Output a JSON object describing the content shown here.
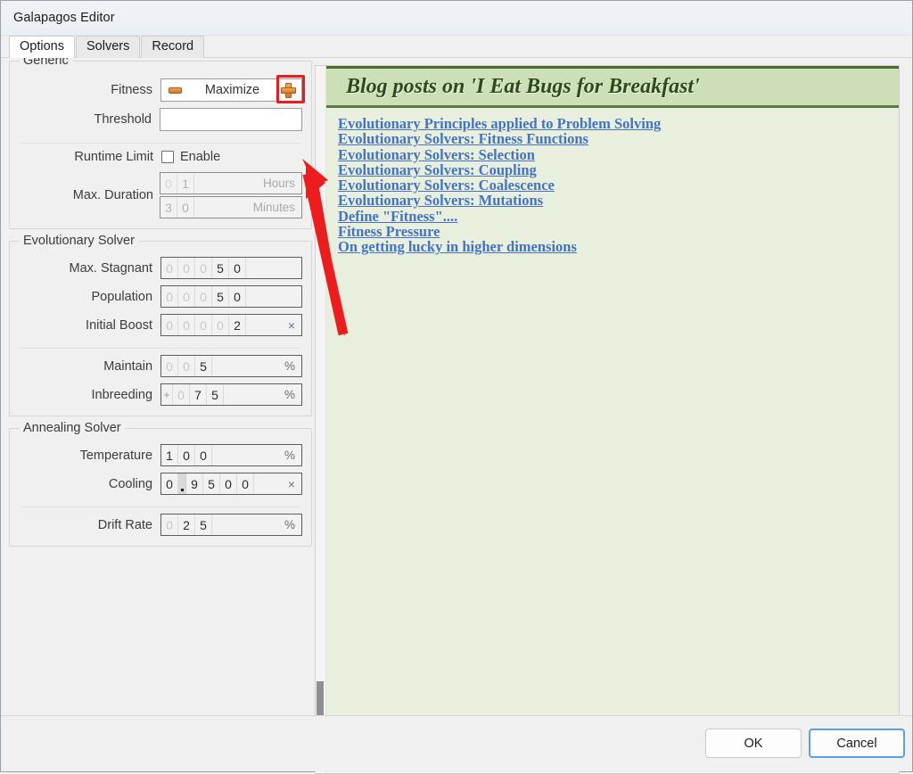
{
  "window": {
    "title": "Galapagos Editor"
  },
  "tabs": [
    {
      "label": "Options",
      "active": true
    },
    {
      "label": "Solvers",
      "active": false
    },
    {
      "label": "Record",
      "active": false
    }
  ],
  "generic": {
    "group_title": "Generic",
    "fitness": {
      "label": "Fitness",
      "value": "Maximize",
      "minus_icon": "minus-icon",
      "plus_icon": "plus-icon",
      "highlight_color": "#e81d1d"
    },
    "threshold": {
      "label": "Threshold",
      "value": "",
      "placeholder": ""
    },
    "runtime_limit": {
      "label": "Runtime Limit",
      "checkbox_label": "Enable",
      "checked": false
    },
    "max_duration": {
      "label": "Max. Duration",
      "hours": {
        "digits": [
          "0",
          "1"
        ],
        "lead_count": 1,
        "unit": "Hours",
        "disabled": true
      },
      "minutes": {
        "digits": [
          "3",
          "0"
        ],
        "lead_count": 0,
        "unit": "Minutes",
        "disabled": true
      }
    }
  },
  "evolutionary_solver": {
    "group_title": "Evolutionary Solver",
    "fields": [
      {
        "label": "Max. Stagnant",
        "digits": [
          "0",
          "0",
          "0",
          "5",
          "0"
        ],
        "lead_count": 3,
        "unit": ""
      },
      {
        "label": "Population",
        "digits": [
          "0",
          "0",
          "0",
          "5",
          "0"
        ],
        "lead_count": 3,
        "unit": ""
      },
      {
        "label": "Initial Boost",
        "digits": [
          "0",
          "0",
          "0",
          "0",
          "2"
        ],
        "lead_count": 4,
        "unit": "×"
      },
      {
        "label": "Maintain",
        "digits": [
          "0",
          "0",
          "5"
        ],
        "lead_count": 2,
        "unit": "%",
        "divider_before": true
      },
      {
        "label": "Inbreeding",
        "sign": "+",
        "digits": [
          "0",
          "7",
          "5"
        ],
        "lead_count": 1,
        "unit": "%"
      }
    ]
  },
  "annealing_solver": {
    "group_title": "Annealing Solver",
    "fields": [
      {
        "label": "Temperature",
        "digits": [
          "1",
          "0",
          "0"
        ],
        "lead_count": 0,
        "unit": "%"
      },
      {
        "label": "Cooling",
        "digits": [
          "0",
          ".",
          "9",
          "5",
          "0",
          "0"
        ],
        "lead_count": 0,
        "unit": "×"
      },
      {
        "label": "Drift Rate",
        "digits": [
          "0",
          "2",
          "5"
        ],
        "lead_count": 1,
        "unit": "%",
        "divider_before": true
      }
    ]
  },
  "blog_panel": {
    "title": "Blog posts on 'I Eat Bugs for Breakfast'",
    "links": [
      "Evolutionary Principles applied to Problem Solving",
      "Evolutionary Solvers: Fitness Functions",
      "Evolutionary Solvers: Selection",
      "Evolutionary Solvers: Coupling",
      "Evolutionary Solvers: Coalescence",
      "Evolutionary Solvers: Mutations",
      "Define \"Fitness\"....",
      "Fitness Pressure",
      "On getting lucky in higher dimensions"
    ],
    "header_bg": "#cddfb6",
    "body_bg": "#e8f0dd",
    "link_color": "#4472c4"
  },
  "footer": {
    "ok_label": "OK",
    "cancel_label": "Cancel"
  }
}
